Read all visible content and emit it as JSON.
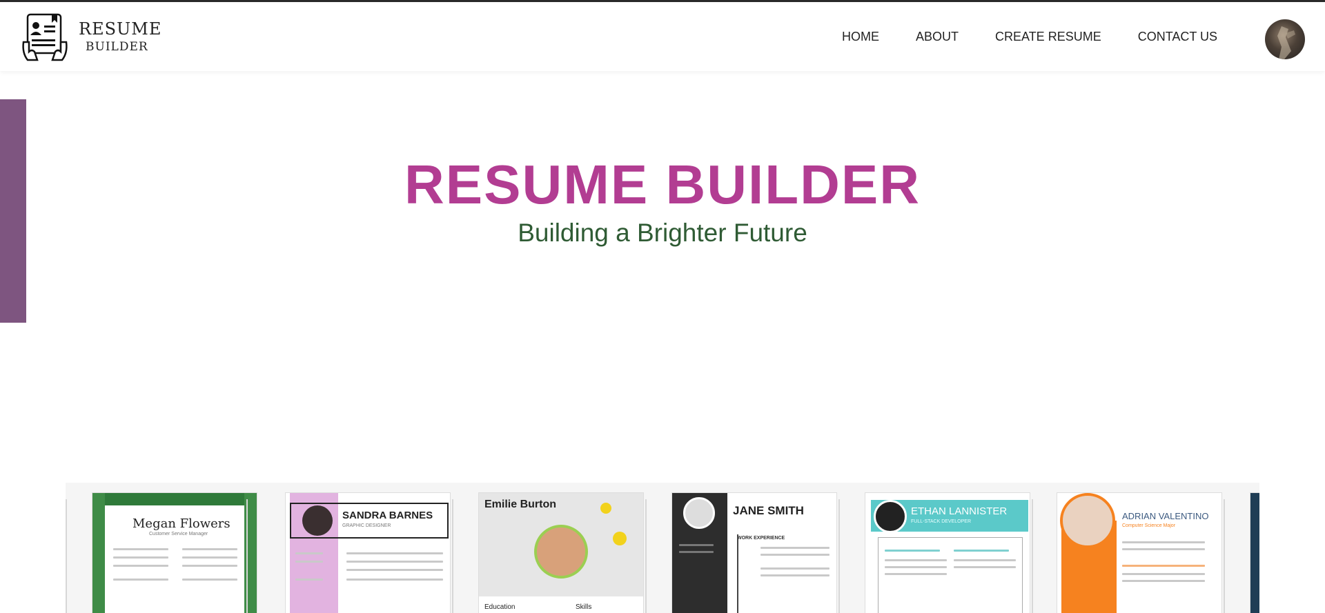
{
  "brand": {
    "line1": "RESUME",
    "line2": "BUILDER"
  },
  "nav": {
    "items": [
      "HOME",
      "ABOUT",
      "CREATE RESUME",
      "CONTACT US"
    ]
  },
  "hero": {
    "title": "RESUME BUILDER",
    "subtitle": "Building a Brighter Future"
  },
  "templates": [
    {
      "name": "Megan Flowers",
      "subtitle": "Customer Service Manager"
    },
    {
      "name": "SANDRA BARNES",
      "subtitle": "GRAPHIC DESIGNER"
    },
    {
      "name": "Emilie Burton",
      "subtitle": "Education",
      "extra": "Skills"
    },
    {
      "name": "JANE SMITH",
      "subtitle": "WORK EXPERIENCE"
    },
    {
      "name": "ETHAN LANNISTER",
      "subtitle": "FULL-STACK DEVELOPER"
    },
    {
      "name": "ADRIAN VALENTINO",
      "subtitle": "Computer Science Major"
    }
  ],
  "colors": {
    "accent": "#b23d92",
    "subtitle": "#2f5b34",
    "sidebar": "#7e5580"
  }
}
